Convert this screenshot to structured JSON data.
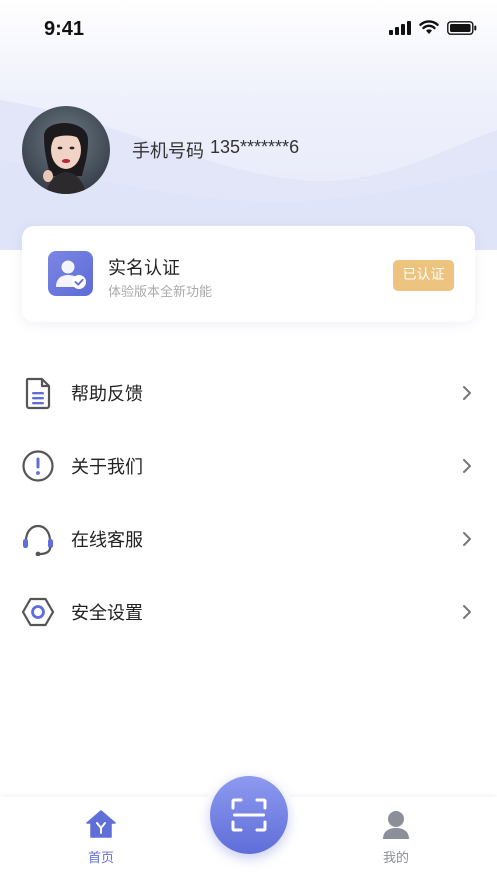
{
  "status_bar": {
    "time": "9:41"
  },
  "profile": {
    "phone_label": "手机号码",
    "phone_number": "135*******6"
  },
  "verification": {
    "title": "实名认证",
    "subtitle": "体验版本全新功能",
    "badge": "已认证",
    "icon": "verified-user-icon"
  },
  "menu": {
    "items": [
      {
        "label": "帮助反馈",
        "icon": "document-icon"
      },
      {
        "label": "关于我们",
        "icon": "info-icon"
      },
      {
        "label": "在线客服",
        "icon": "headset-icon"
      },
      {
        "label": "安全设置",
        "icon": "settings-hexagon-icon"
      }
    ]
  },
  "tabbar": {
    "home_label": "首页",
    "mine_label": "我的",
    "scan_icon": "scan-icon"
  },
  "colors": {
    "accent": "#5f6ed9",
    "badge": "#ecc37f",
    "tab_inactive": "#8a8f99"
  }
}
